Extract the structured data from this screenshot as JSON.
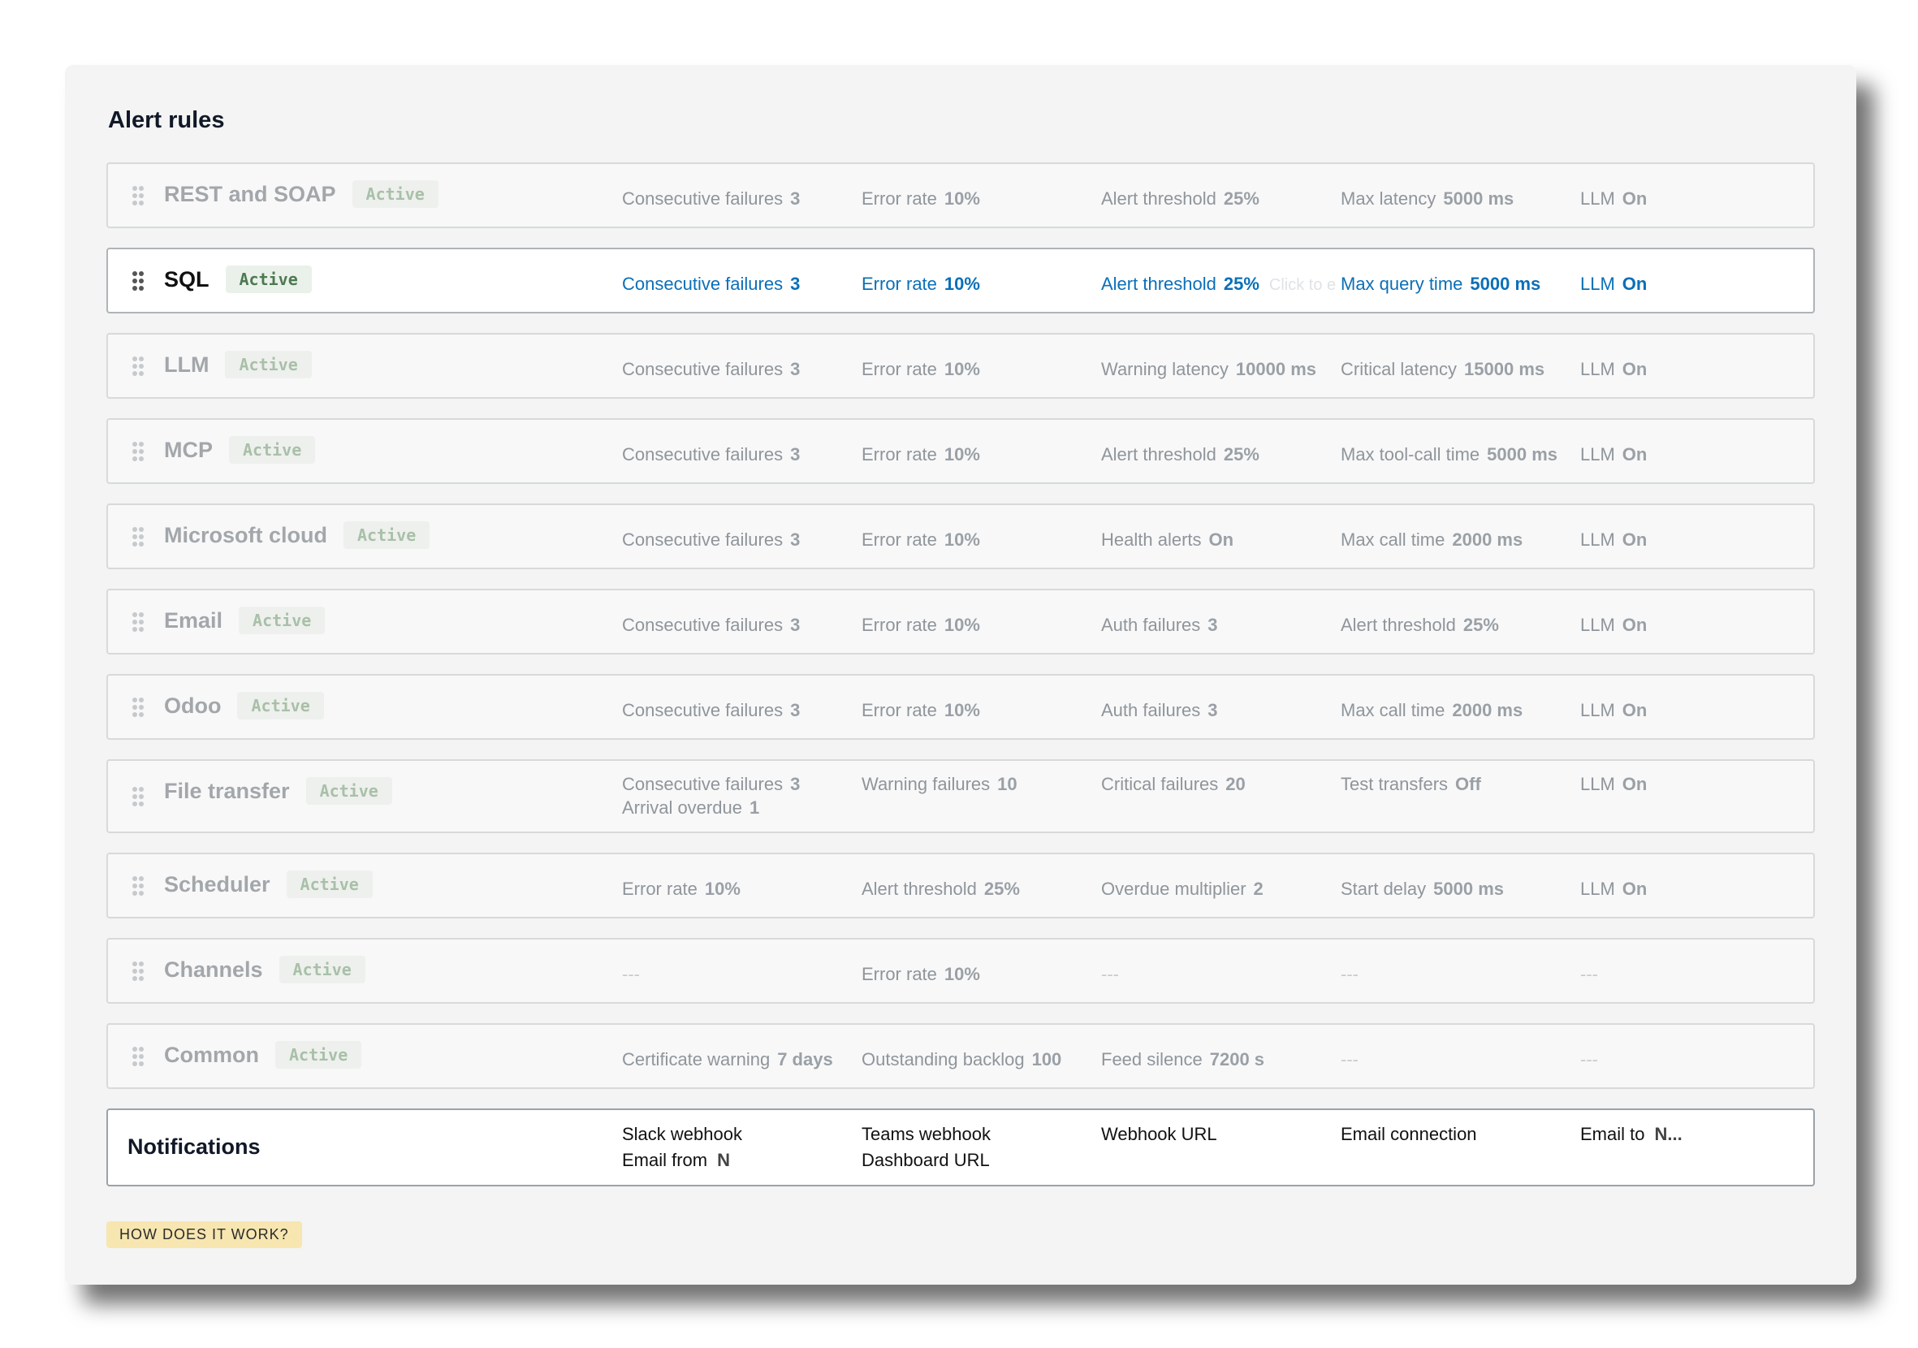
{
  "title": "Alert rules",
  "rules": [
    {
      "name": "REST and SOAP",
      "badge": "Active",
      "active": false,
      "cols": [
        {
          "label": "Consecutive failures",
          "value": "3"
        },
        {
          "label": "Error rate",
          "value": "10%"
        },
        {
          "label": "Alert threshold",
          "value": "25%"
        },
        {
          "label": "Max latency",
          "value": "5000 ms"
        },
        {
          "label": "LLM",
          "value": "On"
        }
      ]
    },
    {
      "name": "SQL",
      "badge": "Active",
      "active": true,
      "hint": "Click to e",
      "cols": [
        {
          "label": "Consecutive failures",
          "value": "3"
        },
        {
          "label": "Error rate",
          "value": "10%"
        },
        {
          "label": "Alert threshold",
          "value": "25%"
        },
        {
          "label": "Max query time",
          "value": "5000 ms"
        },
        {
          "label": "LLM",
          "value": "On"
        }
      ]
    },
    {
      "name": "LLM",
      "badge": "Active",
      "active": false,
      "cols": [
        {
          "label": "Consecutive failures",
          "value": "3"
        },
        {
          "label": "Error rate",
          "value": "10%"
        },
        {
          "label": "Warning latency",
          "value": "10000 ms"
        },
        {
          "label": "Critical latency",
          "value": "15000 ms"
        },
        {
          "label": "LLM",
          "value": "On"
        }
      ]
    },
    {
      "name": "MCP",
      "badge": "Active",
      "active": false,
      "cols": [
        {
          "label": "Consecutive failures",
          "value": "3"
        },
        {
          "label": "Error rate",
          "value": "10%"
        },
        {
          "label": "Alert threshold",
          "value": "25%"
        },
        {
          "label": "Max tool-call time",
          "value": "5000 ms"
        },
        {
          "label": "LLM",
          "value": "On"
        }
      ]
    },
    {
      "name": "Microsoft cloud",
      "badge": "Active",
      "active": false,
      "cols": [
        {
          "label": "Consecutive failures",
          "value": "3"
        },
        {
          "label": "Error rate",
          "value": "10%"
        },
        {
          "label": "Health alerts",
          "value": "On"
        },
        {
          "label": "Max call time",
          "value": "2000 ms"
        },
        {
          "label": "LLM",
          "value": "On"
        }
      ]
    },
    {
      "name": "Email",
      "badge": "Active",
      "active": false,
      "cols": [
        {
          "label": "Consecutive failures",
          "value": "3"
        },
        {
          "label": "Error rate",
          "value": "10%"
        },
        {
          "label": "Auth failures",
          "value": "3"
        },
        {
          "label": "Alert threshold",
          "value": "25%"
        },
        {
          "label": "LLM",
          "value": "On"
        }
      ]
    },
    {
      "name": "Odoo",
      "badge": "Active",
      "active": false,
      "cols": [
        {
          "label": "Consecutive failures",
          "value": "3"
        },
        {
          "label": "Error rate",
          "value": "10%"
        },
        {
          "label": "Auth failures",
          "value": "3"
        },
        {
          "label": "Max call time",
          "value": "2000 ms"
        },
        {
          "label": "LLM",
          "value": "On"
        }
      ]
    },
    {
      "name": "File transfer",
      "badge": "Active",
      "active": false,
      "tall": true,
      "cols": [
        {
          "label": "Consecutive failures",
          "value": "3",
          "label2": "Arrival overdue",
          "value2": "1"
        },
        {
          "label": "Warning failures",
          "value": "10"
        },
        {
          "label": "Critical failures",
          "value": "20"
        },
        {
          "label": "Test transfers",
          "value": "Off"
        },
        {
          "label": "LLM",
          "value": "On"
        }
      ]
    },
    {
      "name": "Scheduler",
      "badge": "Active",
      "active": false,
      "cols": [
        {
          "label": "Error rate",
          "value": "10%"
        },
        {
          "label": "Alert threshold",
          "value": "25%"
        },
        {
          "label": "Overdue multiplier",
          "value": "2"
        },
        {
          "label": "Start delay",
          "value": "5000 ms"
        },
        {
          "label": "LLM",
          "value": "On"
        }
      ]
    },
    {
      "name": "Channels",
      "badge": "Active",
      "active": false,
      "cols": [
        {
          "dash": "---"
        },
        {
          "label": "Error rate",
          "value": "10%"
        },
        {
          "dash": "---"
        },
        {
          "dash": "---"
        },
        {
          "dash": "---"
        }
      ]
    },
    {
      "name": "Common",
      "badge": "Active",
      "active": false,
      "cols": [
        {
          "label": "Certificate warning",
          "value": "7 days"
        },
        {
          "label": "Outstanding backlog",
          "value": "100"
        },
        {
          "label": "Feed silence",
          "value": "7200 s"
        },
        {
          "dash": "---"
        },
        {
          "dash": "---"
        }
      ]
    }
  ],
  "notifications": {
    "title": "Notifications",
    "cols": [
      {
        "line1": "Slack webhook",
        "line2": "Email from",
        "line2_value": "N"
      },
      {
        "line1": "Teams webhook",
        "line2": "Dashboard URL"
      },
      {
        "line1": "Webhook URL"
      },
      {
        "line1": "Email connection"
      },
      {
        "line1": "Email to",
        "line1_value": "N..."
      }
    ]
  },
  "how_button": "HOW DOES IT WORK?",
  "icons": {
    "handle": "drag-handle-icon"
  },
  "colors": {
    "accent": "#0b6fb8",
    "badge_active": "#4d7a50",
    "how_bg": "#f7e6b0"
  }
}
